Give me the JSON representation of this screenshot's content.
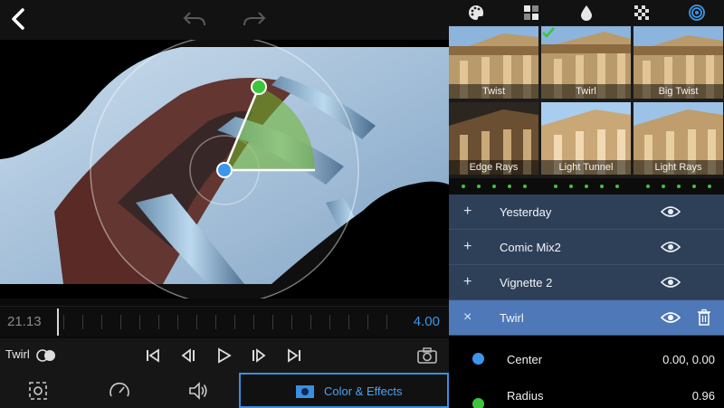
{
  "viewer": {
    "time_start": "21.13",
    "time_end": "4.00"
  },
  "controls": {
    "effect_label": "Twirl"
  },
  "bottom_tabs": {
    "color_effects_label": "Color & Effects"
  },
  "categories": [
    {
      "icon": "palette-icon"
    },
    {
      "icon": "grid-icon"
    },
    {
      "icon": "drop-icon"
    },
    {
      "icon": "noise-icon"
    },
    {
      "icon": "spiral-icon",
      "active": true
    }
  ],
  "presets": [
    {
      "label": "Twist"
    },
    {
      "label": "Twirl",
      "selected": true
    },
    {
      "label": "Big Twist"
    },
    {
      "label": "Edge Rays"
    },
    {
      "label": "Light Tunnel"
    },
    {
      "label": "Light Rays"
    }
  ],
  "layers": [
    {
      "sign": "+",
      "name": "Yesterday"
    },
    {
      "sign": "+",
      "name": "Comic Mix2"
    },
    {
      "sign": "+",
      "name": "Vignette 2"
    },
    {
      "sign": "×",
      "name": "Twirl",
      "selected": true
    }
  ],
  "params": [
    {
      "name": "Center",
      "value": "0.00, 0.00",
      "color": "#3b97ec"
    },
    {
      "name": "Radius",
      "value": "0.96",
      "color": "#3dc53d"
    }
  ],
  "colors": {
    "accent": "#3b97ec",
    "green": "#3dc53d",
    "layer_bg": "#2e3f58",
    "layer_selected": "#4e78b7"
  }
}
